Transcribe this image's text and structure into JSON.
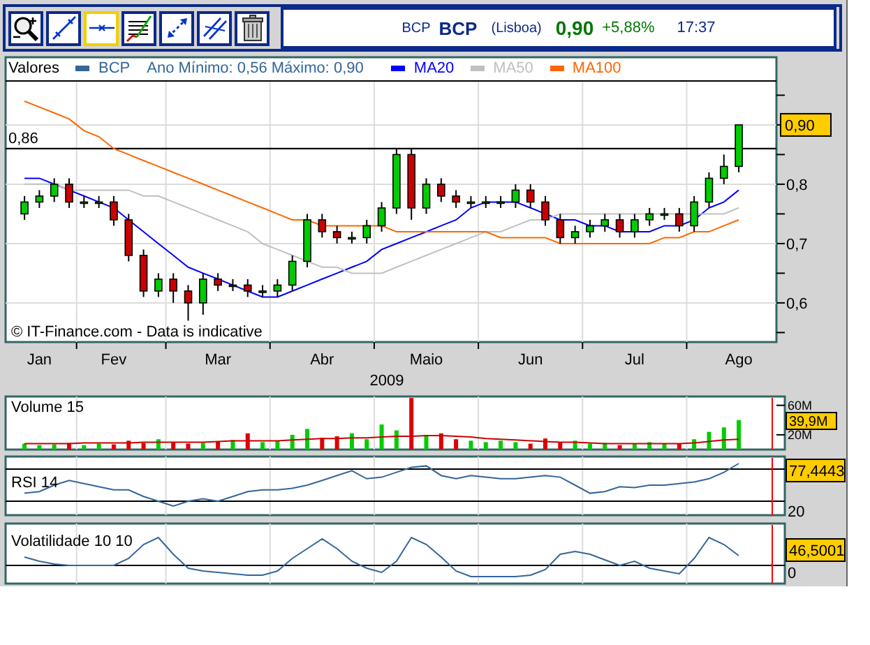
{
  "toolbar": {
    "tools": [
      {
        "kind": "zoom",
        "selected": false
      },
      {
        "kind": "line",
        "selected": false
      },
      {
        "kind": "horizontal",
        "selected": true
      },
      {
        "kind": "grid",
        "selected": false
      },
      {
        "kind": "arrows",
        "selected": false
      },
      {
        "kind": "parallel",
        "selected": false
      },
      {
        "kind": "trash",
        "selected": false
      }
    ]
  },
  "quote": {
    "market_symbol": "BCP",
    "symbol": "BCP",
    "exchange": "(Lisboa)",
    "price": "0,90",
    "change": "+5,88%",
    "time": "17:37"
  },
  "price_chart": {
    "legend_symbol": {
      "label": "BCP",
      "color": "#336699"
    },
    "year_range": "Ano Mínimo: 0,56 Máximo: 0,90",
    "last_value": "0,90",
    "notice": "© IT-Finance.com - Data is indicative",
    "chart_data": {
      "type": "candlestick",
      "title": "Valores",
      "xlabel": "2009",
      "categories": [
        null,
        "Jan",
        null,
        null,
        null,
        null,
        "Fev",
        null,
        null,
        null,
        null,
        null,
        null,
        "Mar",
        null,
        null,
        null,
        null,
        null,
        null,
        "Abr",
        null,
        null,
        null,
        null,
        null,
        null,
        "Maio",
        null,
        null,
        null,
        null,
        null,
        null,
        "Jun",
        null,
        null,
        null,
        null,
        null,
        null,
        "Jul",
        null,
        null,
        null,
        null,
        null,
        null,
        "Ago"
      ],
      "ohlc": [
        [
          0.75,
          0.78,
          0.74,
          0.77
        ],
        [
          0.77,
          0.79,
          0.76,
          0.78
        ],
        [
          0.78,
          0.81,
          0.77,
          0.8
        ],
        [
          0.8,
          0.81,
          0.76,
          0.77
        ],
        [
          0.77,
          0.78,
          0.76,
          0.77
        ],
        [
          0.77,
          0.78,
          0.76,
          0.77
        ],
        [
          0.77,
          0.78,
          0.73,
          0.74
        ],
        [
          0.74,
          0.75,
          0.67,
          0.68
        ],
        [
          0.68,
          0.69,
          0.61,
          0.62
        ],
        [
          0.62,
          0.65,
          0.61,
          0.64
        ],
        [
          0.64,
          0.65,
          0.6,
          0.62
        ],
        [
          0.62,
          0.63,
          0.57,
          0.6
        ],
        [
          0.6,
          0.65,
          0.58,
          0.64
        ],
        [
          0.64,
          0.65,
          0.62,
          0.63
        ],
        [
          0.63,
          0.64,
          0.62,
          0.63
        ],
        [
          0.63,
          0.64,
          0.61,
          0.62
        ],
        [
          0.62,
          0.63,
          0.61,
          0.62
        ],
        [
          0.62,
          0.64,
          0.61,
          0.63
        ],
        [
          0.63,
          0.68,
          0.62,
          0.67
        ],
        [
          0.67,
          0.75,
          0.66,
          0.74
        ],
        [
          0.74,
          0.75,
          0.71,
          0.72
        ],
        [
          0.72,
          0.73,
          0.7,
          0.71
        ],
        [
          0.71,
          0.72,
          0.7,
          0.71
        ],
        [
          0.71,
          0.74,
          0.7,
          0.73
        ],
        [
          0.73,
          0.77,
          0.72,
          0.76
        ],
        [
          0.76,
          0.86,
          0.75,
          0.85
        ],
        [
          0.85,
          0.86,
          0.74,
          0.76
        ],
        [
          0.76,
          0.81,
          0.75,
          0.8
        ],
        [
          0.8,
          0.81,
          0.77,
          0.78
        ],
        [
          0.78,
          0.79,
          0.76,
          0.77
        ],
        [
          0.77,
          0.78,
          0.76,
          0.77
        ],
        [
          0.77,
          0.78,
          0.76,
          0.77
        ],
        [
          0.77,
          0.78,
          0.76,
          0.77
        ],
        [
          0.77,
          0.8,
          0.76,
          0.79
        ],
        [
          0.79,
          0.8,
          0.76,
          0.77
        ],
        [
          0.77,
          0.78,
          0.73,
          0.74
        ],
        [
          0.74,
          0.75,
          0.7,
          0.71
        ],
        [
          0.71,
          0.73,
          0.7,
          0.72
        ],
        [
          0.72,
          0.74,
          0.71,
          0.73
        ],
        [
          0.73,
          0.75,
          0.72,
          0.74
        ],
        [
          0.74,
          0.75,
          0.71,
          0.72
        ],
        [
          0.72,
          0.75,
          0.71,
          0.74
        ],
        [
          0.74,
          0.76,
          0.73,
          0.75
        ],
        [
          0.75,
          0.76,
          0.74,
          0.75
        ],
        [
          0.75,
          0.76,
          0.72,
          0.73
        ],
        [
          0.73,
          0.78,
          0.72,
          0.77
        ],
        [
          0.77,
          0.82,
          0.76,
          0.81
        ],
        [
          0.81,
          0.85,
          0.8,
          0.83
        ],
        [
          0.83,
          0.9,
          0.82,
          0.9
        ]
      ],
      "series": [
        {
          "name": "MA20",
          "type": "line",
          "color": "#0000ff",
          "values": [
            0.81,
            0.81,
            0.8,
            0.79,
            0.78,
            0.77,
            0.76,
            0.74,
            0.72,
            0.7,
            0.68,
            0.66,
            0.65,
            0.64,
            0.63,
            0.62,
            0.61,
            0.61,
            0.62,
            0.63,
            0.64,
            0.65,
            0.66,
            0.67,
            0.69,
            0.7,
            0.71,
            0.72,
            0.73,
            0.74,
            0.76,
            0.77,
            0.77,
            0.77,
            0.76,
            0.75,
            0.74,
            0.74,
            0.73,
            0.73,
            0.72,
            0.72,
            0.72,
            0.73,
            0.73,
            0.74,
            0.76,
            0.77,
            0.79
          ]
        },
        {
          "name": "MA50",
          "type": "line",
          "color": "#c0c0c0",
          "values": [
            0.8,
            0.8,
            0.8,
            0.79,
            0.79,
            0.79,
            0.79,
            0.79,
            0.78,
            0.78,
            0.77,
            0.76,
            0.75,
            0.74,
            0.73,
            0.72,
            0.7,
            0.69,
            0.68,
            0.67,
            0.66,
            0.66,
            0.65,
            0.65,
            0.65,
            0.66,
            0.67,
            0.68,
            0.69,
            0.7,
            0.71,
            0.72,
            0.72,
            0.73,
            0.74,
            0.74,
            0.75,
            0.75,
            0.75,
            0.75,
            0.75,
            0.75,
            0.75,
            0.75,
            0.75,
            0.75,
            0.75,
            0.75,
            0.76
          ]
        },
        {
          "name": "MA100",
          "type": "line",
          "color": "#ff6600",
          "values": [
            0.94,
            0.93,
            0.92,
            0.91,
            0.89,
            0.88,
            0.86,
            0.85,
            0.84,
            0.83,
            0.82,
            0.81,
            0.8,
            0.79,
            0.78,
            0.77,
            0.76,
            0.75,
            0.74,
            0.74,
            0.73,
            0.73,
            0.73,
            0.73,
            0.73,
            0.72,
            0.72,
            0.72,
            0.72,
            0.72,
            0.72,
            0.72,
            0.71,
            0.71,
            0.71,
            0.71,
            0.7,
            0.7,
            0.7,
            0.7,
            0.7,
            0.7,
            0.7,
            0.71,
            0.71,
            0.72,
            0.72,
            0.73,
            0.74
          ]
        }
      ],
      "ylim": [
        0.534,
        0.974
      ],
      "yticks": [
        {
          "value": 0.6,
          "label": "0,6"
        },
        {
          "value": 0.7,
          "label": "0,7"
        },
        {
          "value": 0.8,
          "label": "0,8"
        }
      ],
      "grid": true,
      "ref_lines": [
        {
          "axis": "y",
          "value": 0.86,
          "label": "0,86"
        }
      ]
    }
  },
  "volume_chart": {
    "last_value": "39,9M",
    "chart_data": {
      "type": "bar",
      "title": "Volume 15",
      "categories": [
        null,
        null,
        null,
        null,
        null,
        null,
        null,
        null,
        null,
        null,
        null,
        null,
        null,
        null,
        null,
        null,
        null,
        null,
        null,
        null,
        null,
        null,
        null,
        null,
        null,
        null,
        null,
        null,
        null,
        null,
        null,
        null,
        null,
        null,
        null,
        null,
        null,
        null,
        null,
        null,
        null,
        null,
        null,
        null,
        null,
        null,
        null,
        null,
        null
      ],
      "series": [
        {
          "color": "#00cc00",
          "values": [
            8,
            6,
            7,
            null,
            6,
            8,
            null,
            null,
            null,
            14,
            null,
            null,
            9,
            null,
            13,
            null,
            10,
            12,
            20,
            28,
            null,
            null,
            22,
            14,
            34,
            26,
            null,
            20,
            null,
            null,
            12,
            10,
            12,
            10,
            null,
            null,
            null,
            12,
            8,
            9,
            null,
            8,
            10,
            8,
            null,
            14,
            24,
            30,
            40
          ]
        },
        {
          "color": "#dd0000",
          "values": [
            null,
            null,
            null,
            9,
            null,
            null,
            7,
            12,
            9,
            null,
            10,
            8,
            null,
            11,
            null,
            22,
            null,
            null,
            null,
            null,
            16,
            18,
            null,
            null,
            null,
            null,
            70,
            null,
            22,
            14,
            null,
            null,
            null,
            null,
            8,
            15,
            10,
            null,
            null,
            null,
            6,
            null,
            null,
            null,
            8,
            null,
            null,
            null,
            null
          ]
        },
        {
          "type": "line",
          "color": "#cc0000",
          "values": [
            8,
            8,
            8,
            8,
            9,
            9,
            9,
            9,
            10,
            10,
            10,
            10,
            10,
            11,
            12,
            12,
            12,
            12,
            13,
            14,
            15,
            15,
            16,
            16,
            17,
            18,
            18,
            19,
            19,
            18,
            17,
            15,
            14,
            13,
            12,
            11,
            10,
            10,
            9,
            8,
            8,
            8,
            8,
            8,
            8,
            9,
            11,
            13,
            14
          ]
        }
      ],
      "ylim": [
        0,
        72
      ],
      "yticks": [
        {
          "value": 60,
          "label": "60M"
        },
        {
          "value": 20,
          "label": "20M"
        }
      ]
    }
  },
  "rsi_panel": {
    "title": "RSI 14",
    "last_value": "77,4443",
    "axis_label": "20"
  },
  "volatility_panel": {
    "title": "Volatilidade 10 10",
    "last_value": "46,5001",
    "axis_label": "0"
  }
}
